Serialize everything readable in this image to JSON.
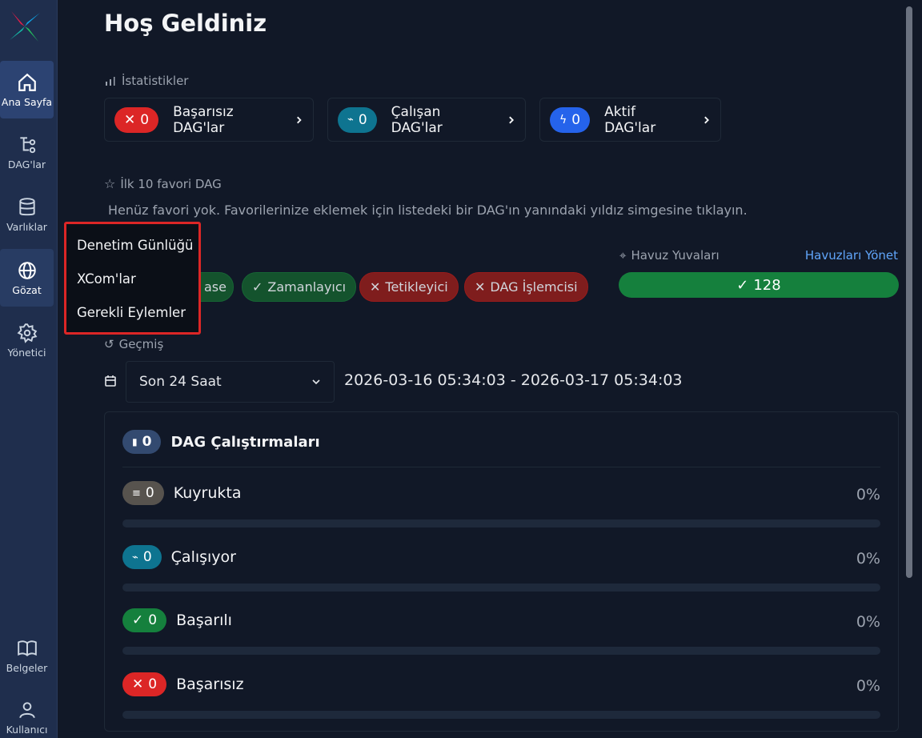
{
  "page": {
    "title": "Hoş Geldiniz"
  },
  "sidebar": {
    "items": [
      {
        "label": "Ana Sayfa",
        "icon": "home-icon"
      },
      {
        "label": "DAG'lar",
        "icon": "dags-icon"
      },
      {
        "label": "Varlıklar",
        "icon": "database-icon"
      },
      {
        "label": "Gözat",
        "icon": "globe-icon"
      },
      {
        "label": "Yönetici",
        "icon": "gear-icon"
      },
      {
        "label": "Belgeler",
        "icon": "book-icon"
      },
      {
        "label": "Kullanıcı",
        "icon": "user-icon"
      }
    ]
  },
  "browse_menu": {
    "items": [
      "Denetim Günlüğü",
      "XCom'lar",
      "Gerekli Eylemler"
    ]
  },
  "stats": {
    "label": "İstatistikler",
    "cards": [
      {
        "count": "0",
        "label": "Başarısız DAG'lar",
        "color": "#dc2626"
      },
      {
        "count": "0",
        "label": "Çalışan DAG'lar",
        "color": "#0891b2"
      },
      {
        "count": "0",
        "label": "Aktif DAG'lar",
        "color": "#2563eb"
      }
    ]
  },
  "favorites": {
    "label": "İlk 10 favori DAG",
    "empty_message": "Henüz favori yok. Favorilerinize eklemek için listedeki bir DAG'ın yanındaki yıldız simgesine tıklayın."
  },
  "health": {
    "badges": [
      {
        "label": "ase",
        "status": "ok"
      },
      {
        "label": "Zamanlayıcı",
        "status": "ok"
      },
      {
        "label": "Tetikleyici",
        "status": "fail"
      },
      {
        "label": "DAG İşlemcisi",
        "status": "fail"
      }
    ]
  },
  "pool": {
    "label": "Havuz Yuvaları",
    "manage_link": "Havuzları Yönet",
    "value": "128"
  },
  "history": {
    "label": "Geçmiş",
    "range_select": "Son 24 Saat",
    "date_range": "2026-03-16 05:34:03 - 2026-03-17 05:34:03"
  },
  "dag_runs": {
    "title": "DAG Çalıştırmaları",
    "count": "0",
    "rows": [
      {
        "label": "Kuyrukta",
        "count": "0",
        "percent": "0%",
        "color": "#57534e",
        "icon": "queue-icon"
      },
      {
        "label": "Çalışıyor",
        "count": "0",
        "percent": "0%",
        "color": "#0891b2",
        "icon": "activity-icon"
      },
      {
        "label": "Başarılı",
        "count": "0",
        "percent": "0%",
        "color": "#15803d",
        "icon": "check-icon"
      },
      {
        "label": "Başarısız",
        "count": "0",
        "percent": "0%",
        "color": "#dc2626",
        "icon": "x-icon"
      }
    ]
  }
}
